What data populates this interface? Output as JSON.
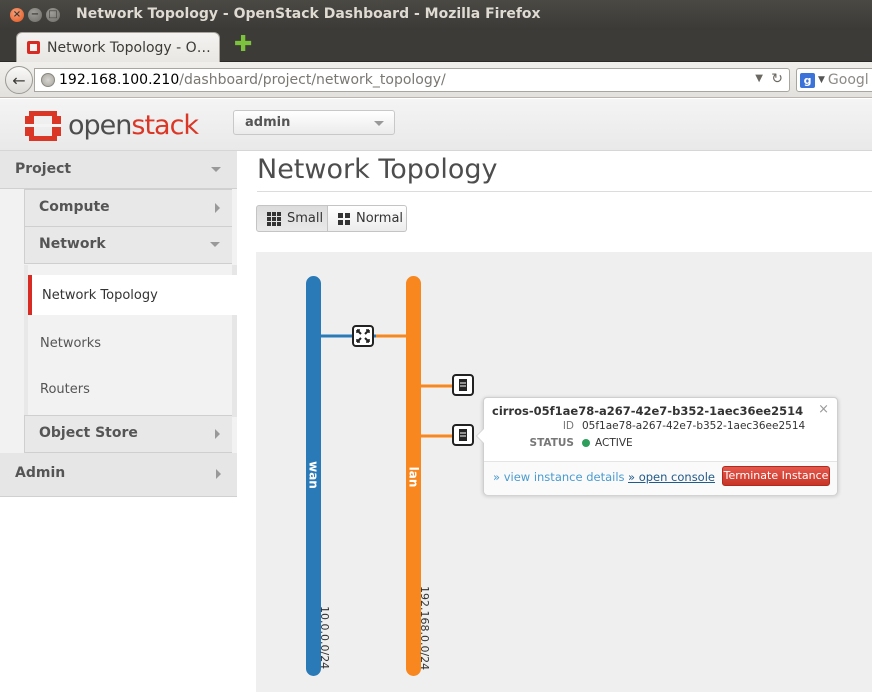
{
  "window": {
    "title": "Network Topology - OpenStack Dashboard - Mozilla Firefox"
  },
  "browser": {
    "tab_title": "Network Topology - O…",
    "url_host": "192.168.100.210",
    "url_path": "/dashboard/project/network_topology/",
    "search_placeholder": "Googl"
  },
  "header": {
    "logo_open": "open",
    "logo_stack": "stack",
    "project_selector": "admin"
  },
  "sidebar": {
    "project": "Project",
    "compute": "Compute",
    "network": "Network",
    "links": [
      "Network Topology",
      "Networks",
      "Routers"
    ],
    "object_store": "Object Store",
    "admin": "Admin"
  },
  "main": {
    "title": "Network Topology",
    "view_small": "Small",
    "view_normal": "Normal"
  },
  "topology": {
    "networks": [
      {
        "name": "wan",
        "cidr": "10.0.0.0/24",
        "color": "#2a7ab8"
      },
      {
        "name": "lan",
        "cidr": "192.168.0.0/24",
        "color": "#f7871e"
      }
    ],
    "router_icon": "router-icon",
    "instance_icon": "instance-icon"
  },
  "popup": {
    "instance_name": "cirros-05f1ae78-a267-42e7-b352-1aec36ee2514",
    "id_label": "ID",
    "id_value": "05f1ae78-a267-42e7-b352-1aec36ee2514",
    "status_label": "STATUS",
    "status_value": "ACTIVE",
    "status_color": "#2e9e5b",
    "view_details": "» view instance details",
    "open_console": "» open console",
    "terminate": "Terminate Instance",
    "close": "×"
  },
  "colors": {
    "brand_red": "#da3726",
    "wan_blue": "#2a7ab8",
    "lan_orange": "#f7871e",
    "terminate_red": "#d4433a"
  }
}
